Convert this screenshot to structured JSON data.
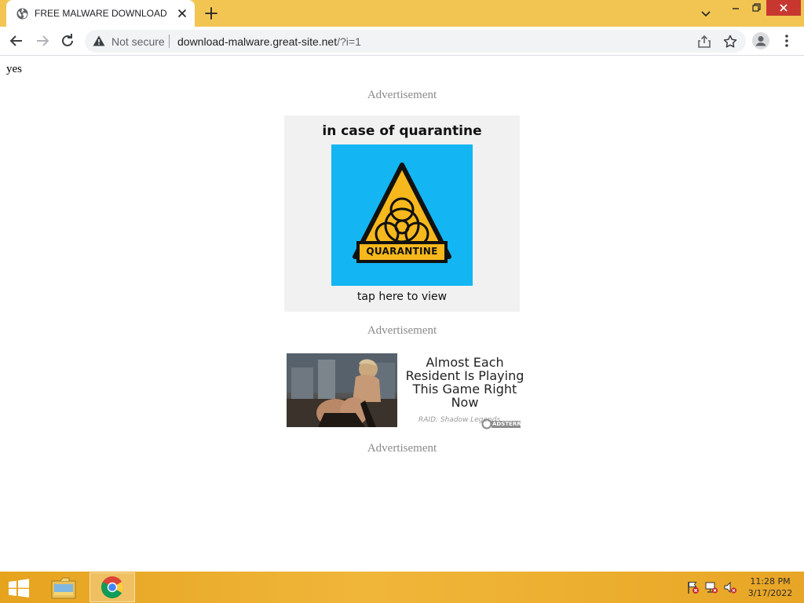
{
  "browser": {
    "tab": {
      "title": "FREE MALWARE DOWNLOAD"
    },
    "omnibox": {
      "security_label": "Not secure",
      "url_host": "download-malware.great-site.net",
      "url_rest": "/?i=1"
    }
  },
  "page": {
    "body_text": "yes",
    "ad_labels": [
      "Advertisement",
      "Advertisement",
      "Advertisement"
    ],
    "ad1": {
      "title": "in case of quarantine",
      "image_text": "QUARANTINE",
      "cta": "tap here to view"
    },
    "ad2": {
      "headline": [
        "Almost Each",
        "Resident Is Playing",
        "This Game Right",
        "Now"
      ],
      "source": "RAID: Shadow Legends",
      "network": "ADSTERRA"
    }
  },
  "taskbar": {
    "time": "11:28 PM",
    "date": "3/17/2022"
  },
  "colors": {
    "tabstrip": "#f2c553",
    "close_button": "#c7372f",
    "ad1_image_bg": "#13b6f2",
    "hazard_yellow": "#f6b81c"
  }
}
